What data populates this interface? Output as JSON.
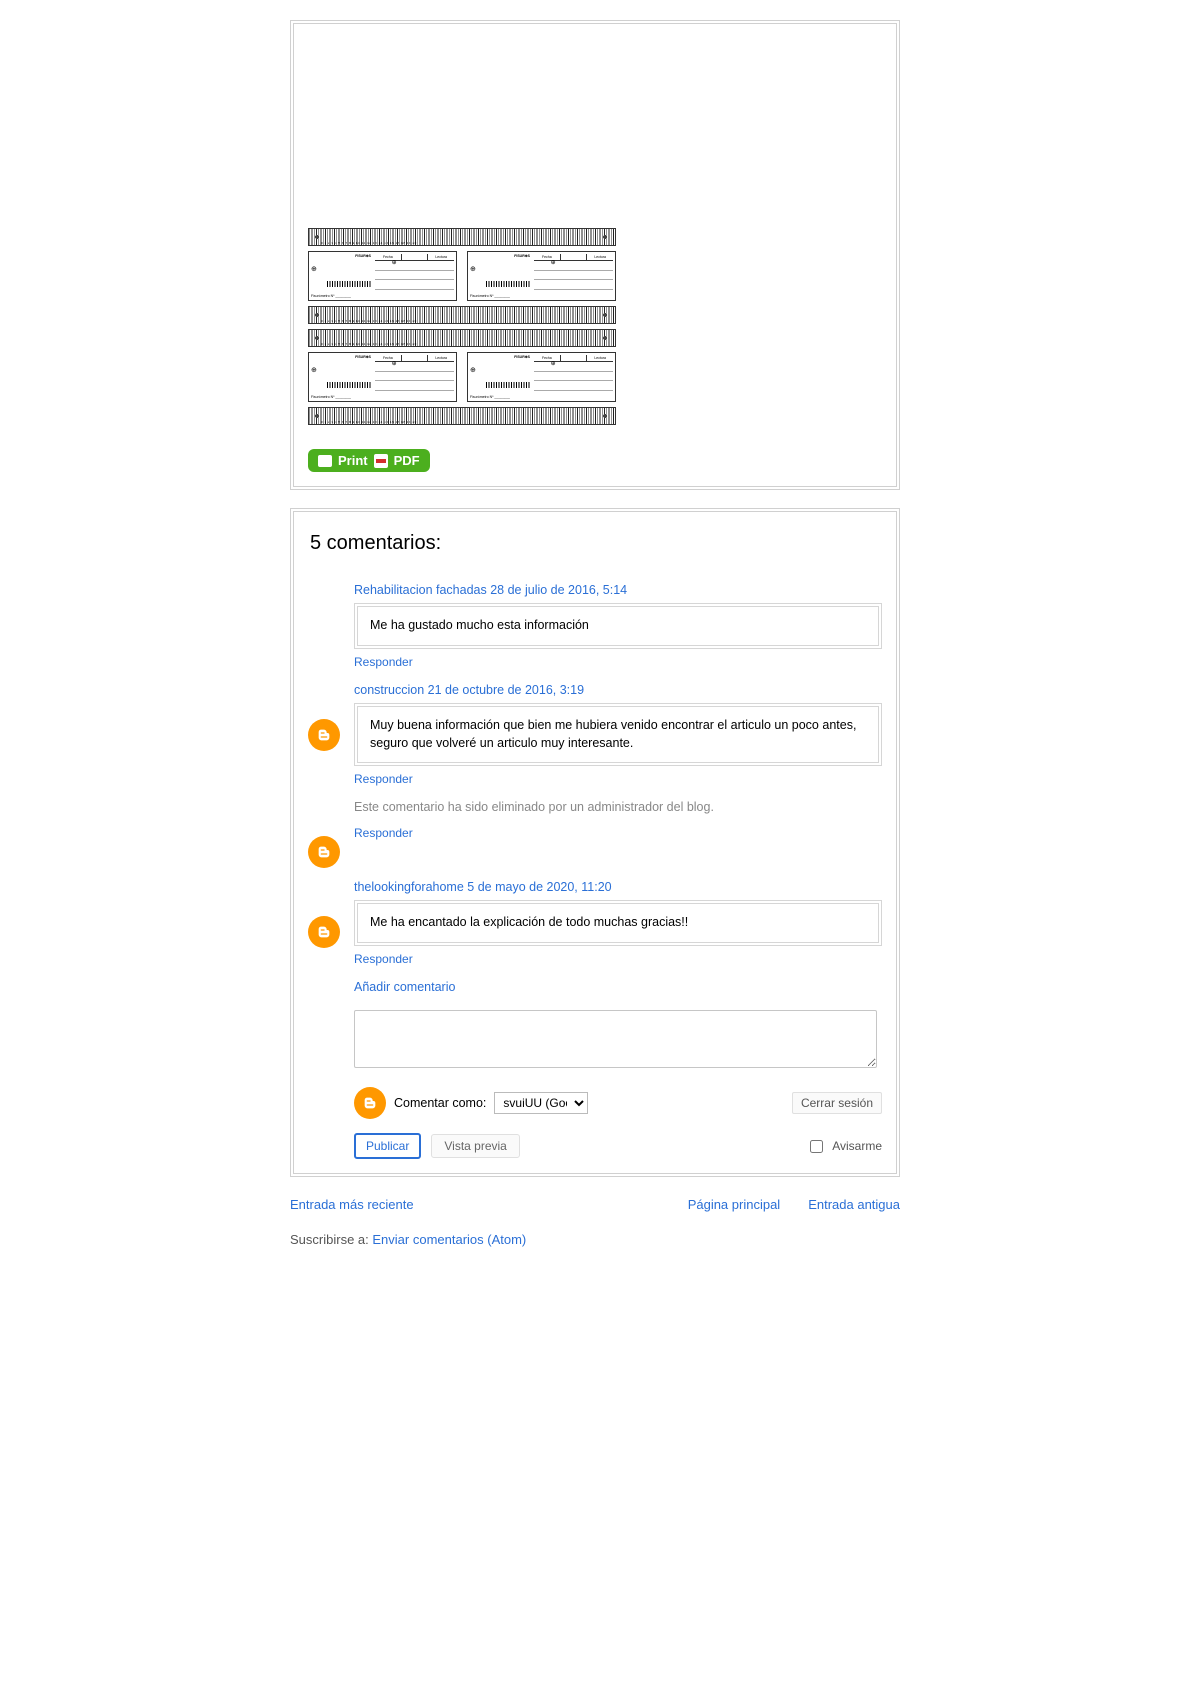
{
  "topCard": {
    "printLabel": "Print",
    "pdfLabel": "PDF",
    "ruler": {
      "brand": "FISUR⊕S",
      "cols": [
        "Fecha",
        "Lectura"
      ],
      "serial": "Fisurómetro Nº ________"
    }
  },
  "commentsCard": {
    "title": "5 comentarios:",
    "comments": [
      {
        "author": "Rehabilitacion fachadas",
        "ts": "28 de julio de 2016, 5:14",
        "text": "Me ha gustado mucho esta información",
        "reply": "Responder"
      },
      {
        "author": "construccion",
        "ts": "21 de octubre de 2016, 3:19",
        "text": "Muy buena información que bien me hubiera venido encontrar el articulo un poco antes, seguro que volveré un articulo muy interesante.",
        "reply": "Responder"
      },
      {
        "removed": true,
        "text": "Este comentario ha sido eliminado por un administrador del blog.",
        "reply": "Responder"
      },
      {
        "author": "thelookingforahome",
        "ts": "5 de mayo de 2020, 11:20",
        "text": "Me ha encantado la explicación de todo muchas gracias!!",
        "reply": "Responder"
      }
    ],
    "addCommentLink": "Añadir comentario",
    "identity": {
      "leadLabel": "Comentar como:",
      "selected": "svuiUU (Google",
      "signout": "Cerrar sesión"
    },
    "actions": {
      "publish": "Publicar",
      "preview": "Vista previa",
      "notify": "Avisarme"
    }
  },
  "navLinks": {
    "newer": "Entrada más reciente",
    "home": "Página principal",
    "older": "Entrada antigua"
  },
  "subscribe": {
    "lead": "Suscribirse a: ",
    "link": "Enviar comentarios (Atom)"
  }
}
